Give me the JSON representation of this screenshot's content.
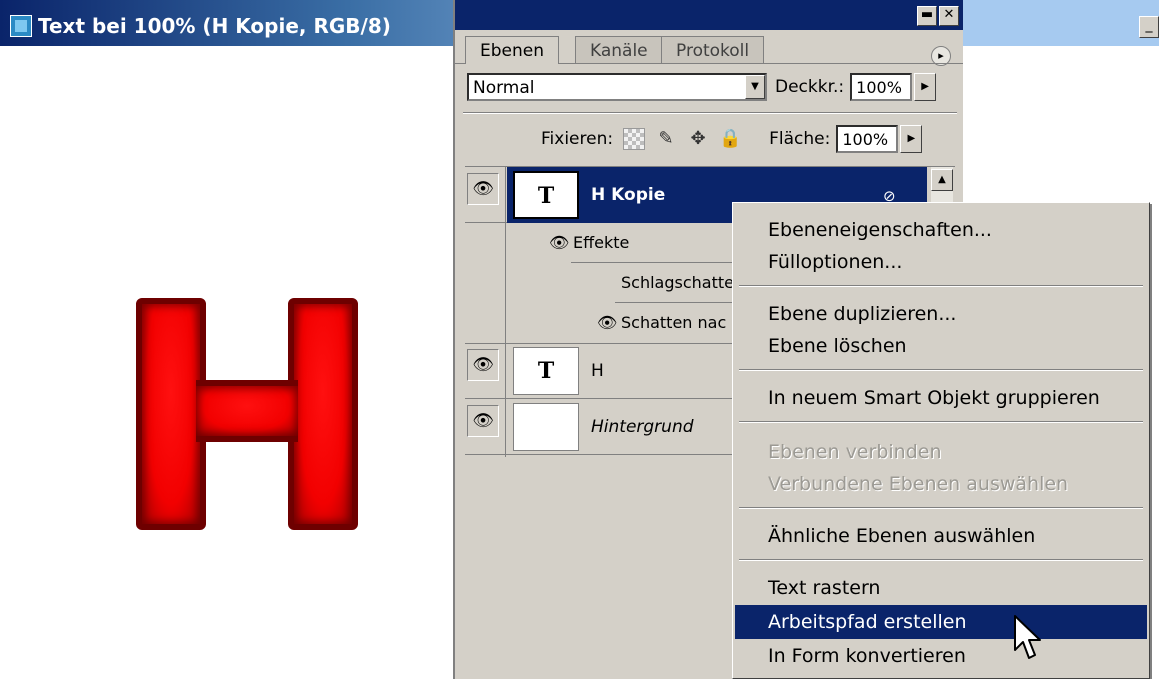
{
  "document": {
    "title": "Text bei 100% (H Kopie, RGB/8)",
    "minimize_glyph": "_",
    "canvas_letter": "H",
    "letter_color": "#ff0000"
  },
  "panel": {
    "window_buttons": [
      "▬",
      "✕"
    ],
    "tabs": [
      {
        "label": "Ebenen",
        "active": true
      },
      {
        "label": "Kanäle",
        "active": false
      },
      {
        "label": "Protokoll",
        "active": false
      }
    ],
    "menu_glyph": "▸",
    "blend_mode": "Normal",
    "opacity_label": "Deckkr.:",
    "opacity_value": "100%",
    "lock_label": "Fixieren:",
    "fill_label": "Fläche:",
    "fill_value": "100%",
    "lock_icons": [
      "transparency-lock-icon",
      "brush-lock-icon",
      "move-lock-icon",
      "padlock-icon"
    ],
    "layers": [
      {
        "name": "H Kopie",
        "type": "text",
        "thumb": "T",
        "selected": true,
        "visible": true
      },
      {
        "name": "H",
        "type": "text",
        "thumb": "T",
        "selected": false,
        "visible": true
      },
      {
        "name": "Hintergrund",
        "type": "image",
        "thumb": "",
        "selected": false,
        "visible": true
      }
    ],
    "effects": {
      "label": "Effekte",
      "items": [
        "Schlagschatte",
        "Schatten nac"
      ]
    },
    "eye_glyph": "👁",
    "fx_glyph": "⊘"
  },
  "context_menu": {
    "items": [
      {
        "label": "Ebeneneigenschaften...",
        "state": "enabled"
      },
      {
        "label": "Fülloptionen...",
        "state": "enabled"
      },
      {
        "label": "Ebene duplizieren...",
        "state": "enabled"
      },
      {
        "label": "Ebene löschen",
        "state": "enabled"
      },
      {
        "label": "In neuem Smart Objekt gruppieren",
        "state": "enabled"
      },
      {
        "label": "Ebenen verbinden",
        "state": "disabled"
      },
      {
        "label": "Verbundene Ebenen auswählen",
        "state": "disabled"
      },
      {
        "label": "Ähnliche Ebenen auswählen",
        "state": "enabled"
      },
      {
        "label": "Text rastern",
        "state": "enabled"
      },
      {
        "label": "Arbeitspfad erstellen",
        "state": "highlighted"
      },
      {
        "label": "In Form konvertieren",
        "state": "enabled"
      }
    ]
  }
}
